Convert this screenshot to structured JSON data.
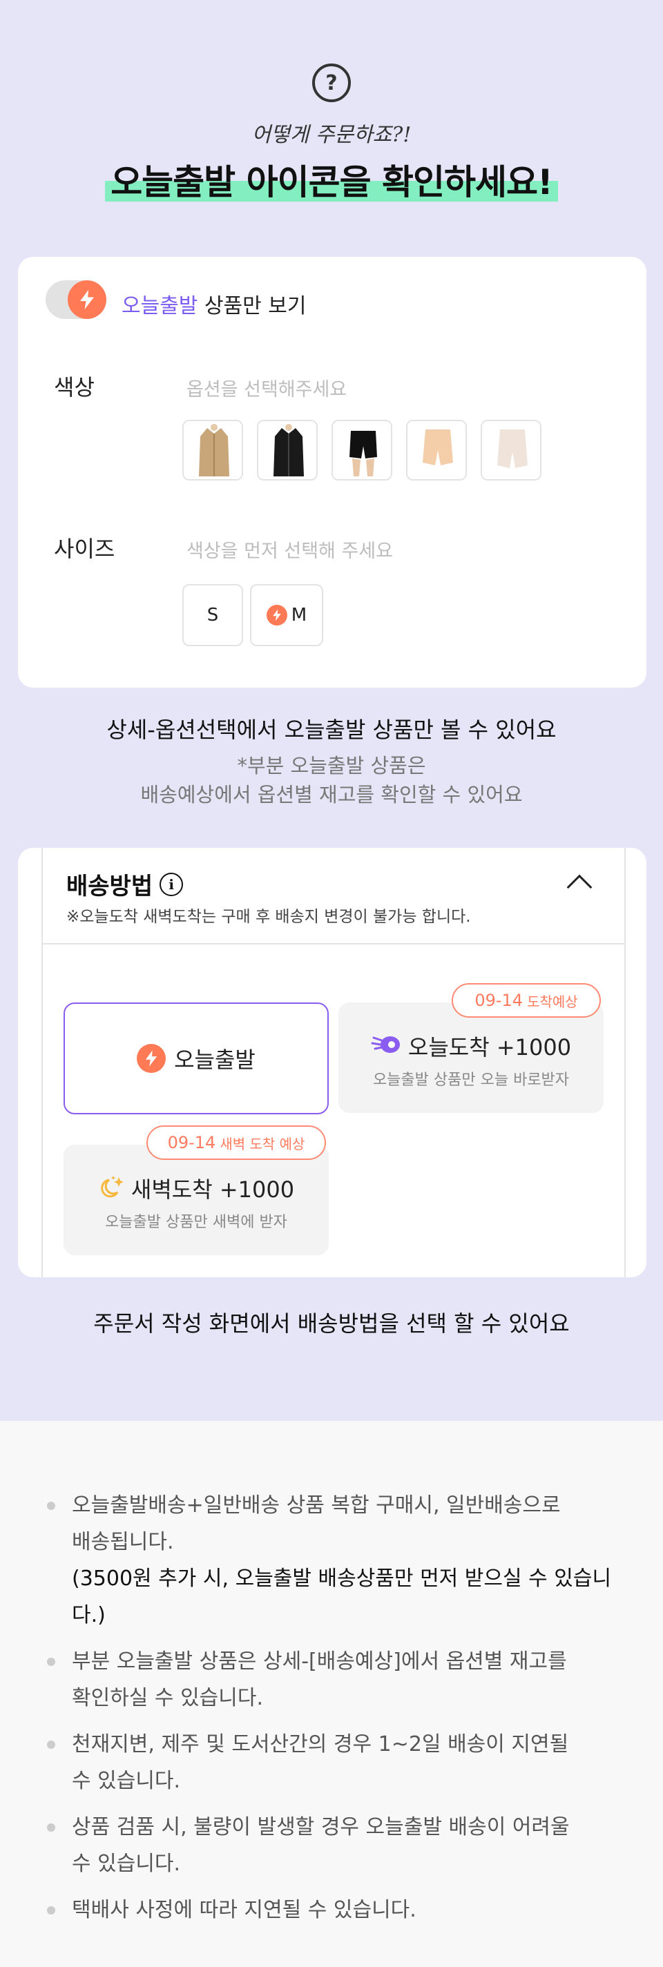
{
  "header": {
    "question_icon": "question-circle-icon",
    "script_text": "어떻게 주문하죠?!",
    "title": "오늘출발 아이콘을 확인하세요!"
  },
  "option_card": {
    "toggle_accent": "오늘출발",
    "toggle_label": " 상품만 보기",
    "color_label": "색상",
    "color_placeholder": "옵션을 선택해주세요",
    "swatches": [
      "beige-coat",
      "black-coat",
      "black-shorts",
      "nude-shorts",
      "ivory-shorts"
    ],
    "size_label": "사이즈",
    "size_placeholder": "색상을 먼저 선택해 주세요",
    "sizes": [
      "S",
      "M"
    ]
  },
  "caption1": {
    "main": "상세-옵션선택에서 오늘출발 상품만 볼 수 있어요",
    "sub1": "*부분 오늘출발 상품은",
    "sub2": "배송예상에서 옵션별 재고를 확인할 수 있어요"
  },
  "shipping_card": {
    "title": "배송방법",
    "info_icon": "i",
    "note": "※오늘도착 새벽도착는 구매 후 배송지 변경이 불가능 합니다.",
    "options": [
      {
        "title": "오늘출발"
      },
      {
        "title": "오늘도착 +1000",
        "subtitle": "오늘출발 상품만 오늘 바로받자",
        "badge_date": "09-14",
        "badge_text": "도착예상"
      },
      {
        "title": "새벽도착 +1000",
        "subtitle": "오늘출발 상품만 새벽에 받자",
        "badge_date": "09-14",
        "badge_text": "새벽 도착 예상"
      }
    ]
  },
  "caption2": "주문서 작성 화면에서 배송방법을 선택 할 수 있어요",
  "notes": [
    {
      "line1": "오늘출발배송+일반배송 상품 복합 구매시, 일반배송으로",
      "line2": "배송됩니다.",
      "line3": "(3500원 추가 시, 오늘출발 배송상품만 먼저 받으실 수 있습니다.)"
    },
    {
      "line1": "부분 오늘출발 상품은 상세-[배송예상]에서 옵션별 재고를",
      "line2": "확인하실 수 있습니다."
    },
    {
      "line1": "천재지변, 제주 및 도서산간의 경우 1~2일 배송이 지연될",
      "line2": "수 있습니다."
    },
    {
      "line1": "상품 검품 시, 불량이 발생할 경우 오늘출발 배송이 어려울",
      "line2": "수 있습니다."
    },
    {
      "line1": "택배사 사정에 따라 지연될 수 있습니다."
    }
  ],
  "colors": {
    "page_bg": "#e6e4f7",
    "accent_purple": "#7b5cf0",
    "lightning_orange": "#ff7a55",
    "highlight_green": "#83eec0",
    "badge_coral": "#ff8a73"
  }
}
